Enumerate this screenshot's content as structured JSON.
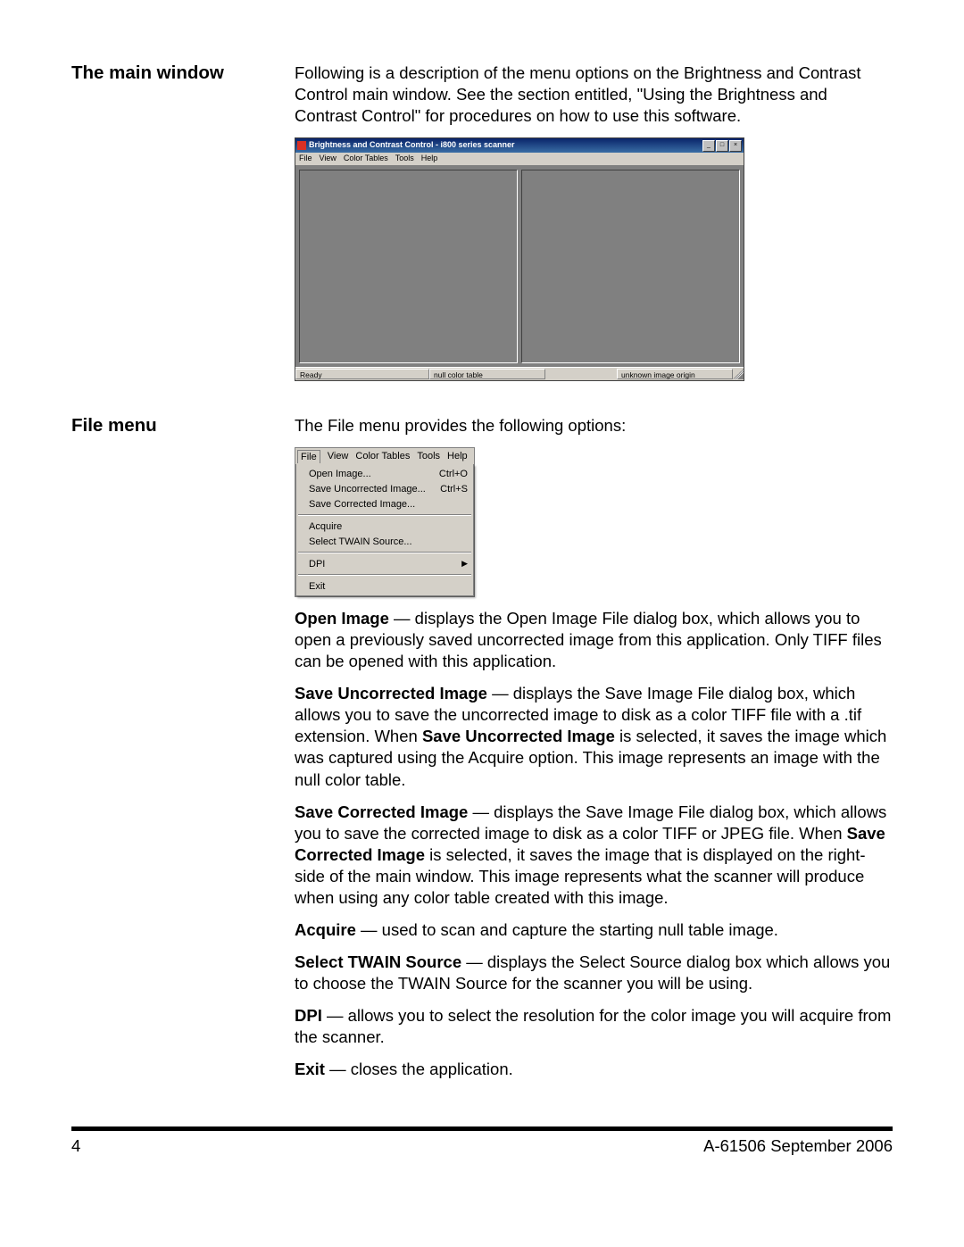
{
  "sections": {
    "main_window": {
      "heading": "The main window",
      "intro": "Following is a description of the menu options on the Brightness and Contrast Control main window. See the section entitled, \"Using the Brightness and Contrast Control\" for procedures on how to use this software."
    },
    "file_menu": {
      "heading": "File menu",
      "intro": "The File menu provides the following options:"
    }
  },
  "app_window": {
    "title": "Brightness and Contrast Control - i800 series scanner",
    "menus": [
      "File",
      "View",
      "Color Tables",
      "Tools",
      "Help"
    ],
    "status": {
      "ready": "Ready",
      "color_table": "null color table",
      "origin": "unknown image origin"
    },
    "win_buttons": {
      "min": "_",
      "max": "□",
      "close": "×"
    }
  },
  "file_dropdown": {
    "menubar": [
      "File",
      "View",
      "Color Tables",
      "Tools",
      "Help"
    ],
    "items": [
      {
        "label": "Open Image...",
        "accel": "Ctrl+O"
      },
      {
        "label": "Save Uncorrected Image...",
        "accel": "Ctrl+S"
      },
      {
        "label": "Save Corrected Image...",
        "accel": ""
      }
    ],
    "items2": [
      {
        "label": "Acquire",
        "accel": ""
      },
      {
        "label": "Select TWAIN Source...",
        "accel": ""
      }
    ],
    "items3": [
      {
        "label": "DPI",
        "accel": "▶"
      }
    ],
    "items4": [
      {
        "label": "Exit",
        "accel": ""
      }
    ]
  },
  "descriptions": {
    "open_image": {
      "term": "Open Image",
      "text": " — displays the Open Image File dialog box, which allows you to open a previously saved uncorrected image from this application. Only TIFF files can be opened with this application."
    },
    "save_uncorrected": {
      "term": "Save Uncorrected Image",
      "pre": " — displays the Save Image File dialog box, which allows you to save the uncorrected image to disk as a color TIFF file with a .tif extension. When ",
      "bold2": "Save Uncorrected Image",
      "post": " is selected, it saves the image which was captured using the Acquire option. This image represents an image with the null color table."
    },
    "save_corrected": {
      "term": "Save Corrected Image",
      "pre": " — displays the Save Image File dialog box, which allows you to save the corrected image to disk as a color TIFF or JPEG file. When ",
      "bold2": "Save Corrected Image",
      "post": " is selected, it saves the image that is displayed on the right-side of the main window. This image represents what the scanner will produce when using any color table created with this image."
    },
    "acquire": {
      "term": "Acquire",
      "text": " — used to scan and capture the starting null table image."
    },
    "select_twain": {
      "term": "Select TWAIN Source",
      "text": " — displays the Select Source dialog box which allows you to choose the TWAIN Source for the scanner you will be using."
    },
    "dpi": {
      "term": "DPI",
      "text": " — allows you to select the resolution for the color image you will acquire from the scanner."
    },
    "exit": {
      "term": "Exit",
      "text": " — closes the application."
    }
  },
  "footer": {
    "page": "4",
    "docid": "A-61506  September 2006"
  }
}
